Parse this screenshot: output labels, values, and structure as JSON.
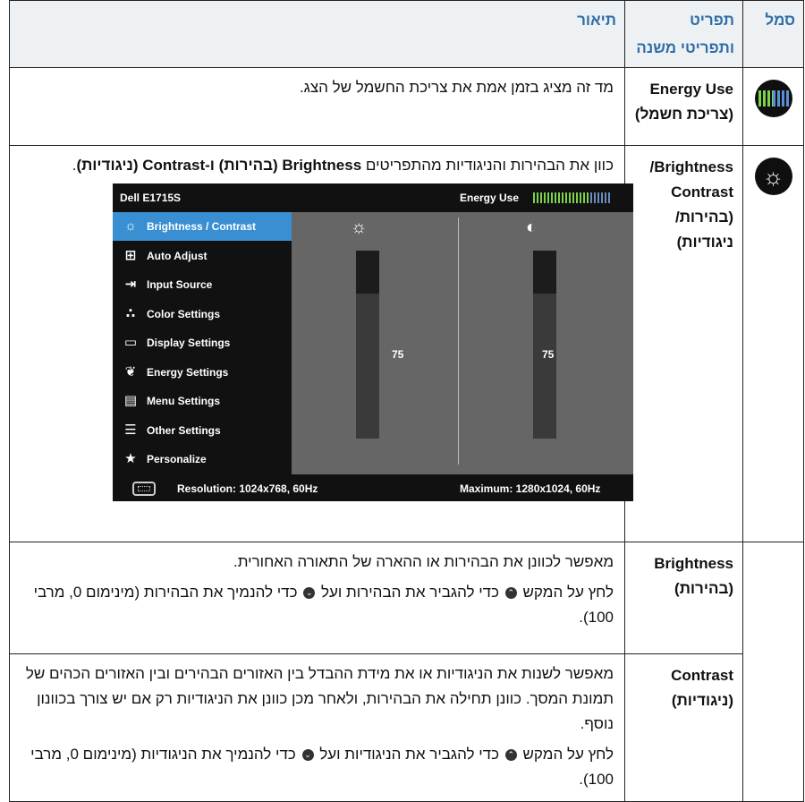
{
  "header": {
    "col_icon": "סמל",
    "col_item": "תפריט ותפריטי משנה",
    "col_desc": "תיאור"
  },
  "rows": {
    "energy": {
      "name_en": "Energy Use",
      "name_he": "(צריכת חשמל)",
      "desc": "מד זה מציג בזמן אמת את צריכת החשמל של הצג.",
      "icon": "energy-meter-icon"
    },
    "bc": {
      "name_en": "Brightness/",
      "name_en2": "Contrast",
      "name_he": "(בהירות/",
      "name_he2": "ניגודיות)",
      "icon": "sun-icon",
      "desc_prefix": "כוון את הבהירות והניגודיות מהתפריטים ",
      "desc_bold1": "Brightness (בהירות)",
      "desc_mid": "",
      "desc_bold2": "ו-Contrast (ניגודיות)",
      "desc_end": "."
    },
    "brightness": {
      "name_en": "Brightness",
      "name_he": "(בהירות)",
      "p1": "מאפשר לכוונן את הבהירות או ההארה של התאורה האחורית.",
      "p2a": "לחץ על המקש",
      "p2b": "כדי להגביר את הבהירות ועל",
      "p2c": "כדי להנמיך את",
      "p2d": "הבהירות (מינימום 0, מרבי 100)."
    },
    "contrast": {
      "name_en": "Contrast",
      "name_he": "(ניגודיות)",
      "p1": "מאפשר לשנות את הניגודיות או את מידת ההבדל בין האזורים הבהירים ובין האזורים הכהים של תמונת המסך. כוונן תחילה את הבהירות, ולאחר מכן כוונן את הניגודיות רק אם יש צורך בכוונון נוסף.",
      "p2a": "לחץ על המקש",
      "p2b": "כדי להגביר את הניגודיות ועל",
      "p2c": "כדי להנמיך את",
      "p2d": "הניגודיות (מינימום 0, מרבי 100)."
    }
  },
  "osd": {
    "model": "Dell E1715S",
    "energy_label": "Energy Use",
    "energy_level": 0.75,
    "menu": [
      {
        "label": "Brightness / Contrast",
        "icon": "sun-icon",
        "glyph": "☼"
      },
      {
        "label": "Auto Adjust",
        "icon": "auto-adjust-icon",
        "glyph": "⊞"
      },
      {
        "label": "Input Source",
        "icon": "input-source-icon",
        "glyph": "⇥"
      },
      {
        "label": "Color Settings",
        "icon": "color-dots-icon",
        "glyph": "∴"
      },
      {
        "label": "Display Settings",
        "icon": "display-icon",
        "glyph": "▭"
      },
      {
        "label": "Energy Settings",
        "icon": "leaf-icon",
        "glyph": "❦"
      },
      {
        "label": "Menu Settings",
        "icon": "menu-icon",
        "glyph": "▤"
      },
      {
        "label": "Other Settings",
        "icon": "sliders-icon",
        "glyph": "☰"
      },
      {
        "label": "Personalize",
        "icon": "star-icon",
        "glyph": "★"
      }
    ],
    "brightness_value": "75",
    "contrast_value": "75",
    "brightness_icon": "☼",
    "contrast_icon": "◐",
    "resolution": "Resolution: 1024x768, 60Hz",
    "maximum": "Maximum: 1280x1024, 60Hz",
    "nav": {
      "up": "⌃",
      "down": "⌄",
      "enter": "→",
      "exit": "✕"
    },
    "accent": "#3a8fd2",
    "exit_color": "#e3262d"
  }
}
